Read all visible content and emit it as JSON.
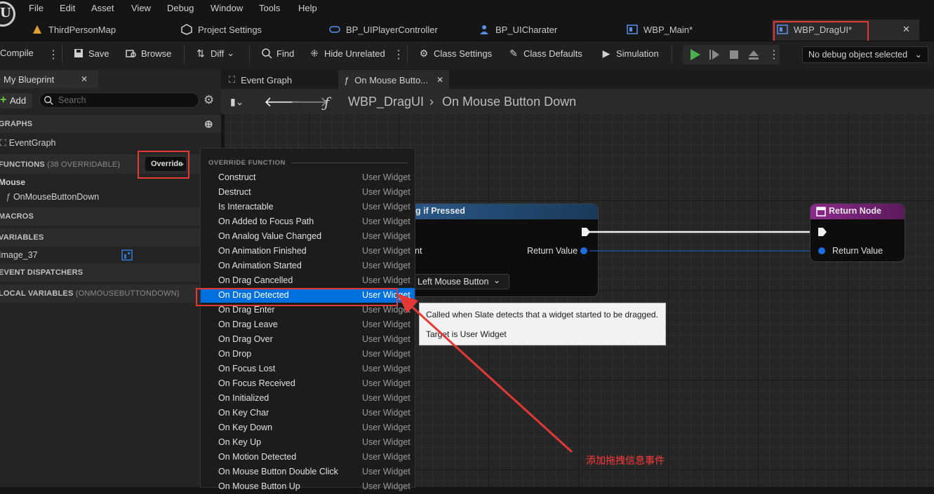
{
  "menu": [
    "File",
    "Edit",
    "Asset",
    "View",
    "Debug",
    "Window",
    "Tools",
    "Help"
  ],
  "tabs": [
    {
      "label": "ThirdPersonMap"
    },
    {
      "label": "Project Settings"
    },
    {
      "label": "BP_UIPlayerController"
    },
    {
      "label": "BP_UICharater"
    },
    {
      "label": "WBP_Main*"
    },
    {
      "label": "WBP_DragUI*"
    }
  ],
  "toolbar": {
    "compile": "Compile",
    "save": "Save",
    "browse": "Browse",
    "diff": "Diff",
    "find": "Find",
    "hide_unrelated": "Hide Unrelated",
    "class_settings": "Class Settings",
    "class_defaults": "Class Defaults",
    "simulation": "Simulation",
    "debug_object": "No debug object selected"
  },
  "left_panel": {
    "tab": "My Blueprint",
    "add": "Add",
    "search_placeholder": "Search",
    "graphs_header": "GRAPHS",
    "event_graph": "EventGraph",
    "functions_header": "FUNCTIONS",
    "functions_count": "(38 OVERRIDABLE)",
    "override": "Override",
    "mouse_category": "Mouse",
    "function_item": "OnMouseButtonDown",
    "macros_header": "MACROS",
    "variables_header": "VARIABLES",
    "variable_item": "Image_37",
    "dispatchers_header": "EVENT DISPATCHERS",
    "local_vars_header": "LOCAL VARIABLES",
    "local_vars_scope": "(ONMOUSEBUTTONDOWN)"
  },
  "graph": {
    "tabs": [
      {
        "label": "Event Graph"
      },
      {
        "label": "On Mouse Butto..."
      }
    ],
    "breadcrumb_root": "WBP_DragUI",
    "breadcrumb_current": "On Mouse Button Down",
    "node_left": {
      "title_fragment": "g if Pressed",
      "pin_fragment": "nt",
      "return_value": "Return Value",
      "key": "Left Mouse Button"
    },
    "node_return": {
      "title": "Return Node",
      "return_value": "Return Value"
    }
  },
  "override_menu": {
    "header": "OVERRIDE FUNCTION",
    "items": [
      {
        "name": "Construct",
        "cat": "User Widget"
      },
      {
        "name": "Destruct",
        "cat": "User Widget"
      },
      {
        "name": "Is Interactable",
        "cat": "User Widget"
      },
      {
        "name": "On Added to Focus Path",
        "cat": "User Widget"
      },
      {
        "name": "On Analog Value Changed",
        "cat": "User Widget"
      },
      {
        "name": "On Animation Finished",
        "cat": "User Widget"
      },
      {
        "name": "On Animation Started",
        "cat": "User Widget"
      },
      {
        "name": "On Drag Cancelled",
        "cat": "User Widget"
      },
      {
        "name": "On Drag Detected",
        "cat": "User Widget"
      },
      {
        "name": "On Drag Enter",
        "cat": "User Widget"
      },
      {
        "name": "On Drag Leave",
        "cat": "User Widget"
      },
      {
        "name": "On Drag Over",
        "cat": "User Widget"
      },
      {
        "name": "On Drop",
        "cat": "User Widget"
      },
      {
        "name": "On Focus Lost",
        "cat": "User Widget"
      },
      {
        "name": "On Focus Received",
        "cat": "User Widget"
      },
      {
        "name": "On Initialized",
        "cat": "User Widget"
      },
      {
        "name": "On Key Char",
        "cat": "User Widget"
      },
      {
        "name": "On Key Down",
        "cat": "User Widget"
      },
      {
        "name": "On Key Up",
        "cat": "User Widget"
      },
      {
        "name": "On Motion Detected",
        "cat": "User Widget"
      },
      {
        "name": "On Mouse Button Double Click",
        "cat": "User Widget"
      },
      {
        "name": "On Mouse Button Up",
        "cat": "User Widget"
      }
    ]
  },
  "tooltip": {
    "line1": "Called when Slate detects that a widget started to be dragged.",
    "line2": "Target is User Widget"
  },
  "annotation": "添加拖拽信息事件",
  "colors": {
    "accent_blue": "#0070e0",
    "annotation_red": "#e53935",
    "return_node_header": "#8c2a8c"
  }
}
